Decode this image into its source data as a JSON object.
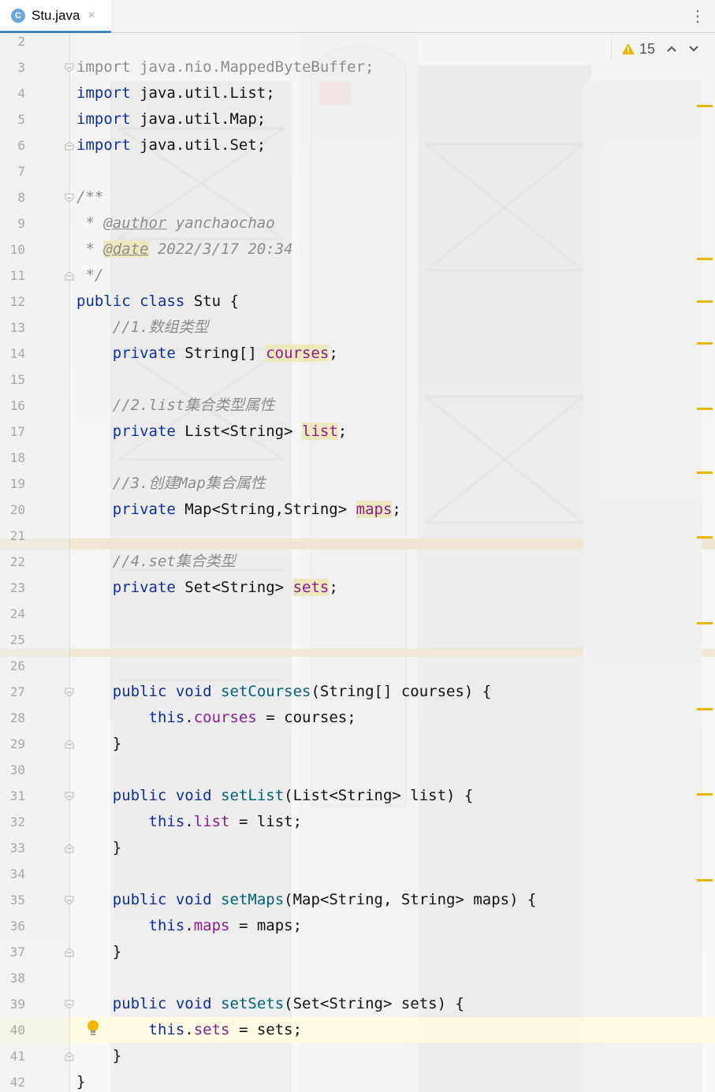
{
  "tab": {
    "icon_letter": "C",
    "title": "Stu.java",
    "close": "×"
  },
  "toolbar": {
    "more": "⋮"
  },
  "inspections": {
    "warning_count": "15",
    "up": "⌃",
    "down": "⌄"
  },
  "lines": [
    {
      "n": "2",
      "html": ""
    },
    {
      "n": "3",
      "html": "<span class=\"imp\">import java.nio.MappedByteBuffer;</span>"
    },
    {
      "n": "4",
      "html": "<span class=\"kw\">import</span> java.util.List;"
    },
    {
      "n": "5",
      "html": "<span class=\"kw\">import</span> java.util.Map;"
    },
    {
      "n": "6",
      "html": "<span class=\"kw\">import</span> java.util.Set;"
    },
    {
      "n": "7",
      "html": ""
    },
    {
      "n": "8",
      "html": "<span class=\"cm\">/**</span>"
    },
    {
      "n": "9",
      "html": "<span class=\"cm\"> * </span><span class=\"tag\">@author</span><span class=\"cm\"> yanchaochao</span>"
    },
    {
      "n": "10",
      "html": "<span class=\"cm\"> * </span><span class=\"tag hl\">@date</span><span class=\"cm\"> 2022/3/17 20:34</span>"
    },
    {
      "n": "11",
      "html": "<span class=\"cm\"> */</span>"
    },
    {
      "n": "12",
      "html": "<span class=\"kw\">public class</span> Stu {"
    },
    {
      "n": "13",
      "html": "    <span class=\"cm\">//1.数组类型</span>"
    },
    {
      "n": "14",
      "html": "    <span class=\"kw\">private</span> String[] <span class=\"fld hl\">courses</span>;"
    },
    {
      "n": "15",
      "html": ""
    },
    {
      "n": "16",
      "html": "    <span class=\"cm\">//2.list集合类型属性</span>"
    },
    {
      "n": "17",
      "html": "    <span class=\"kw\">private</span> List&lt;String&gt; <span class=\"fld hl\">list</span>;"
    },
    {
      "n": "18",
      "html": ""
    },
    {
      "n": "19",
      "html": "    <span class=\"cm\">//3.创建Map集合属性</span>"
    },
    {
      "n": "20",
      "html": "    <span class=\"kw\">private</span> Map&lt;String,String&gt; <span class=\"fld hl\">maps</span>;"
    },
    {
      "n": "21",
      "html": ""
    },
    {
      "n": "22",
      "html": "    <span class=\"cm\">//4.set集合类型</span>"
    },
    {
      "n": "23",
      "html": "    <span class=\"kw\">private</span> Set&lt;String&gt; <span class=\"fld hl\">sets</span>;"
    },
    {
      "n": "24",
      "html": ""
    },
    {
      "n": "25",
      "html": ""
    },
    {
      "n": "26",
      "html": ""
    },
    {
      "n": "27",
      "html": "    <span class=\"kw\">public void</span> <span class=\"fn\">setCourses</span>(String[] courses) {"
    },
    {
      "n": "28",
      "html": "        <span class=\"kw\">this</span>.<span class=\"fld\">courses</span> = courses;"
    },
    {
      "n": "29",
      "html": "    }"
    },
    {
      "n": "30",
      "html": ""
    },
    {
      "n": "31",
      "html": "    <span class=\"kw\">public void</span> <span class=\"fn\">setList</span>(List&lt;String&gt; list) {"
    },
    {
      "n": "32",
      "html": "        <span class=\"kw\">this</span>.<span class=\"fld\">list</span> = list;"
    },
    {
      "n": "33",
      "html": "    }"
    },
    {
      "n": "34",
      "html": ""
    },
    {
      "n": "35",
      "html": "    <span class=\"kw\">public void</span> <span class=\"fn\">setMaps</span>(Map&lt;String, String&gt; maps) {"
    },
    {
      "n": "36",
      "html": "        <span class=\"kw\">this</span>.<span class=\"fld\">maps</span> = maps;"
    },
    {
      "n": "37",
      "html": "    }"
    },
    {
      "n": "38",
      "html": ""
    },
    {
      "n": "39",
      "html": "    <span class=\"kw\">public void</span> <span class=\"fn\">setSets</span>(Set&lt;String&gt; sets) {"
    },
    {
      "n": "40",
      "html": "        <span class=\"kw\">this</span>.<span class=\"fld\">sets</span> = sets;"
    },
    {
      "n": "41",
      "html": "    }"
    },
    {
      "n": "42",
      "html": "}"
    }
  ],
  "colors": {
    "keyword": "#0b2fa0",
    "field": "#8a1d8e",
    "comment": "#8c8c8c",
    "warning": "#e8b500",
    "tab_accent": "#4083c9"
  },
  "icons": {
    "tab": "java-class-icon",
    "warning": "warning-triangle-icon",
    "bulb": "lightbulb-icon",
    "fold": "fold-marker-icon"
  }
}
